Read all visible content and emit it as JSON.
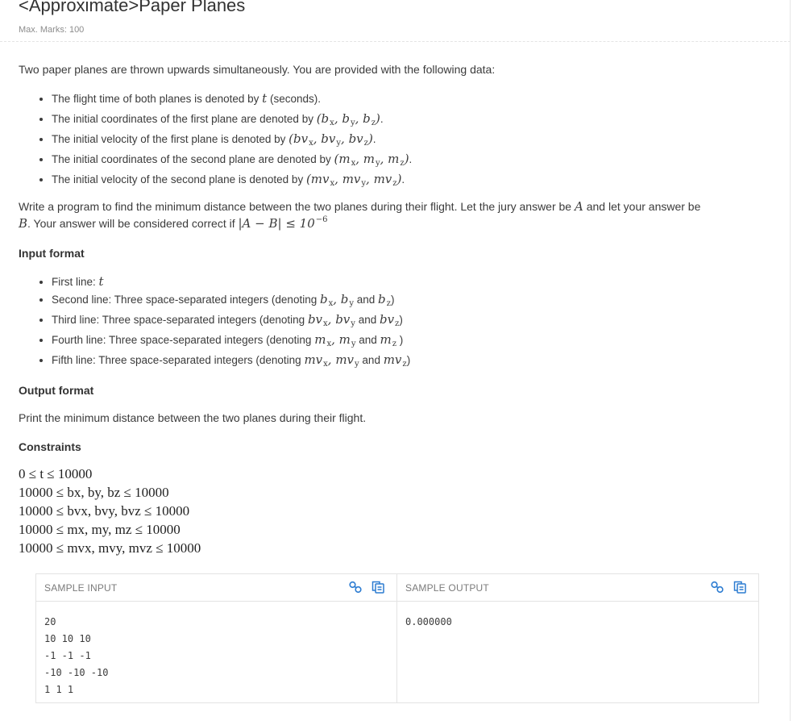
{
  "problem": {
    "title": "<Approximate>Paper Planes",
    "max_marks": "Max. Marks: 100",
    "intro": "Two paper planes are thrown upwards simultaneously. You are provided with the following data:",
    "data_items": [
      {
        "text": "The flight time of both planes is denoted by ",
        "math": "t",
        "suffix": " (seconds)."
      },
      {
        "text": "The initial coordinates of the first plane are denoted by ",
        "math": "(bx, by, bz)",
        "suffix": "."
      },
      {
        "text": "The initial velocity of the first plane is denoted by ",
        "math": "(bvx, bvy, bvz)",
        "suffix": "."
      },
      {
        "text": "The initial coordinates of the second plane are denoted by ",
        "math": "(mx, my, mz)",
        "suffix": "."
      },
      {
        "text": "The initial velocity of the second plane is denoted by ",
        "math": "(mvx, mvy, mvz)",
        "suffix": "."
      }
    ],
    "task_line1": "Write a program to find the minimum distance between the two planes during their flight. Let the jury answer be",
    "task_A": "A",
    "task_mid": "and let your answer be",
    "task_B": "B",
    "task_line2": ". Your answer will be considered correct if",
    "task_cond": "|A − B| ≤ 10",
    "task_exp": "−6",
    "input_heading": "Input format",
    "input_items": [
      {
        "text": "First line: ",
        "math": "t",
        "suffix": ""
      },
      {
        "text": "Second line: Three space-separated integers (denoting ",
        "math": "bx, by and bz",
        "suffix": ")"
      },
      {
        "text": "Third line: Three space-separated integers (denoting ",
        "math": "bvx, bvy and bvz",
        "suffix": ")"
      },
      {
        "text": "Fourth line: Three space-separated integers (denoting ",
        "math": "mx, my and mz",
        "suffix": " )"
      },
      {
        "text": "Fifth line: Three space-separated integers (denoting ",
        "math": "mvx, mvy and mvz",
        "suffix": ")"
      }
    ],
    "output_heading": "Output format",
    "output_text": "Print the minimum distance between the two planes during their flight.",
    "constraints_heading": "Constraints",
    "constraints": [
      "0 ≤ t ≤ 10000",
      "10000 ≤ bx, by, bz ≤ 10000",
      "10000 ≤ bvx, bvy, bvz ≤ 10000",
      "10000 ≤ mx, my, mz ≤ 10000",
      "10000 ≤ mvx, mvy, mvz ≤ 10000"
    ]
  },
  "sample": {
    "input_label": "SAMPLE INPUT",
    "output_label": "SAMPLE OUTPUT",
    "input_lines": [
      "20",
      "10 10 10",
      "-1 -1 -1",
      "-10 -10 -10",
      "1 1 1"
    ],
    "output_lines": [
      "0.000000"
    ],
    "accent": "#2b7bd1"
  }
}
